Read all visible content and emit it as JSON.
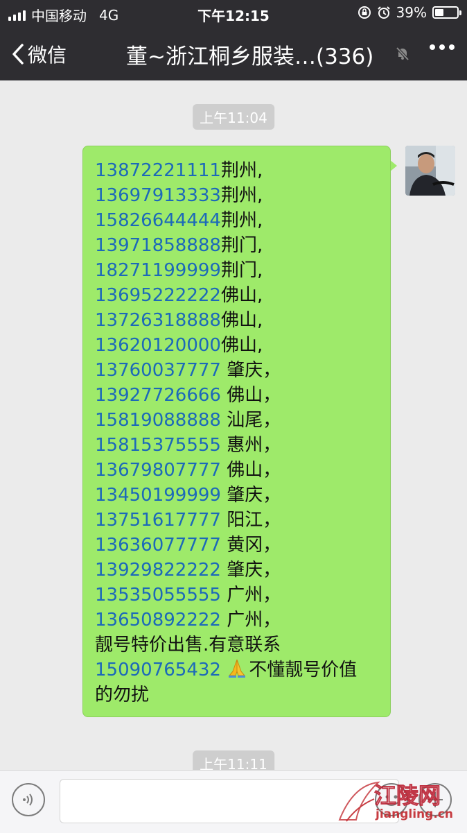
{
  "status_bar": {
    "carrier": "中国移动",
    "network": "4G",
    "time": "下午12:15",
    "battery_text": "39%",
    "battery_level": 0.39
  },
  "nav": {
    "back_label": "微信",
    "title": "董~浙江桐乡服装…(336)"
  },
  "chat": {
    "timestamps": [
      "上午11:04",
      "上午11:11"
    ],
    "message_lines": [
      {
        "phone": "13872221111",
        "sep": "",
        "text": "荆州,"
      },
      {
        "phone": "13697913333",
        "sep": "",
        "text": "荆州,"
      },
      {
        "phone": "15826644444",
        "sep": "",
        "text": "荆州,"
      },
      {
        "phone": "13971858888",
        "sep": "",
        "text": "荆门,"
      },
      {
        "phone": "18271199999",
        "sep": "",
        "text": "荆门,"
      },
      {
        "phone": "13695222222",
        "sep": "",
        "text": "佛山,"
      },
      {
        "phone": "13726318888",
        "sep": "",
        "text": "佛山,"
      },
      {
        "phone": "13620120000",
        "sep": "",
        "text": "佛山,"
      },
      {
        "phone": "13760037777",
        "sep": " ",
        "text": "肇庆，"
      },
      {
        "phone": "13927726666",
        "sep": " ",
        "text": "佛山，"
      },
      {
        "phone": "15819088888",
        "sep": " ",
        "text": "汕尾，"
      },
      {
        "phone": "15815375555",
        "sep": " ",
        "text": "惠州，"
      },
      {
        "phone": "13679807777",
        "sep": " ",
        "text": "佛山，"
      },
      {
        "phone": "13450199999",
        "sep": " ",
        "text": "肇庆，"
      },
      {
        "phone": "13751617777",
        "sep": " ",
        "text": "阳江，"
      },
      {
        "phone": "13636077777",
        "sep": " ",
        "text": "黄冈，"
      },
      {
        "phone": "13929822222",
        "sep": " ",
        "text": "肇庆，"
      },
      {
        "phone": "13535055555",
        "sep": " ",
        "text": "广州，"
      },
      {
        "phone": "13650892222",
        "sep": " ",
        "text": "广州，"
      }
    ],
    "sale_text": "靓号特价出售.有意联系",
    "contact_phone": "15090765432",
    "contact_sep": " ",
    "contact_text": "不懂靓号价值",
    "closing_text": "的勿扰"
  },
  "watermark": {
    "name": "江陵网",
    "url": "jiangling.cn"
  },
  "colors": {
    "nav_bg": "#2e2d31",
    "bubble_bg": "#9eea6a",
    "phone_link": "#1c69b9",
    "chat_bg": "#ebebeb"
  },
  "icons": [
    "signal-icon",
    "lock-rotation-icon",
    "alarm-icon",
    "battery-icon",
    "back-chevron-icon",
    "mute-icon",
    "more-icon",
    "voice-icon",
    "emoji-icon",
    "plus-icon",
    "pray-emoji-icon"
  ]
}
